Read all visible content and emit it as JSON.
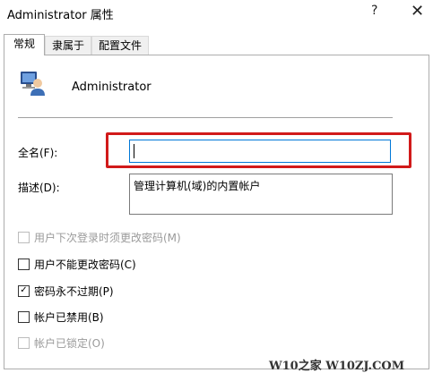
{
  "window": {
    "title": "Administrator 属性",
    "help_glyph": "?",
    "close_glyph": "✕"
  },
  "tabs": [
    {
      "label": "常规",
      "active": true
    },
    {
      "label": "隶属于",
      "active": false
    },
    {
      "label": "配置文件",
      "active": false
    }
  ],
  "user": {
    "name": "Administrator",
    "icon": "user-account-icon"
  },
  "fields": {
    "fullname_label": "全名(F):",
    "fullname_value": "",
    "description_label": "描述(D):",
    "description_value": "管理计算机(域)的内置帐户"
  },
  "checkboxes": [
    {
      "label": "用户下次登录时须更改密码(M)",
      "checked": false,
      "enabled": false
    },
    {
      "label": "用户不能更改密码(C)",
      "checked": false,
      "enabled": true
    },
    {
      "label": "密码永不过期(P)",
      "checked": true,
      "enabled": true
    },
    {
      "label": "帐户已禁用(B)",
      "checked": false,
      "enabled": true
    },
    {
      "label": "帐户已锁定(O)",
      "checked": false,
      "enabled": false
    }
  ],
  "watermark": "W10之家 W10ZJ.COM",
  "colors": {
    "highlight": "#d11a1a",
    "focus_border": "#0078d7"
  }
}
